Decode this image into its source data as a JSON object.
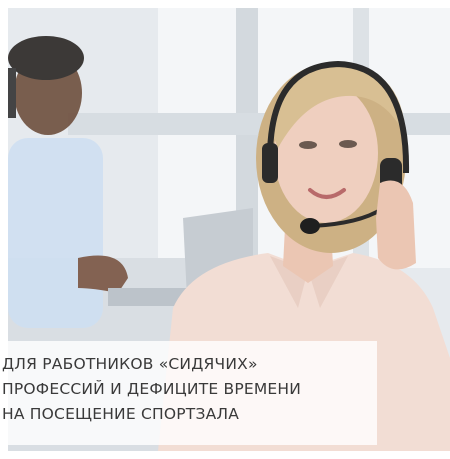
{
  "caption": {
    "lines": [
      "ДЛЯ РАБОТНИКОВ «СИДЯЧИХ»",
      "ПРОФЕССИЙ  И ДЕФИЦИТЕ ВРЕМЕНИ",
      "НА ПОСЕЩЕНИЕ СПОРТЗАЛА"
    ]
  },
  "photo": {
    "subject": "woman-with-headset",
    "palette": {
      "background": "#e6eaee",
      "window": "#f6f8fa",
      "hair": "#d8bf93",
      "skin": "#efcfbf",
      "blouse": "#f2ddd4",
      "headset": "#2b2b2b",
      "colleague_shirt": "#cfe0f2"
    }
  }
}
